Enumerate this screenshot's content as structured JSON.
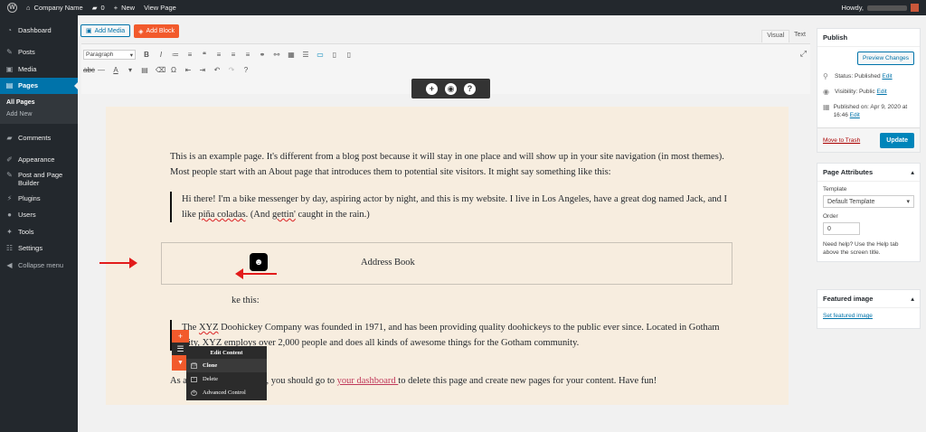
{
  "adminbar": {
    "site_name": "Company Name",
    "comments_count": "0",
    "new_label": "New",
    "view_label": "View Page",
    "howdy": "Howdy,"
  },
  "sidebar": {
    "items": [
      {
        "label": "Dashboard",
        "icon": "dashboard-icon"
      },
      {
        "label": "Posts",
        "icon": "pin-icon"
      },
      {
        "label": "Media",
        "icon": "media-icon"
      },
      {
        "label": "Pages",
        "icon": "pages-icon"
      },
      {
        "label": "Comments",
        "icon": "comment-icon"
      },
      {
        "label": "Appearance",
        "icon": "brush-icon"
      },
      {
        "label": "Post and Page Builder",
        "icon": "builder-icon"
      },
      {
        "label": "Plugins",
        "icon": "plug-icon"
      },
      {
        "label": "Users",
        "icon": "users-icon"
      },
      {
        "label": "Tools",
        "icon": "wrench-icon"
      },
      {
        "label": "Settings",
        "icon": "settings-icon"
      },
      {
        "label": "Collapse menu",
        "icon": "collapse-icon"
      }
    ],
    "submenu": [
      "All Pages",
      "Add New"
    ]
  },
  "editor": {
    "add_media": "Add Media",
    "add_block": "Add Block",
    "tab_visual": "Visual",
    "tab_text": "Text",
    "format": "Paragraph",
    "p1": "This is an example page. It's different from a blog post because it will stay in one place and will show up in your site navigation (in most themes). Most people start with an About page that introduces them to potential site visitors. It might say something like this:",
    "q1_a": "Hi there! I'm a bike messenger by day, aspiring actor by night, and this is my website. I live in Los Angeles, have a great dog named Jack, and I like ",
    "q1_b": "piña coladas",
    "q1_c": ". (And ",
    "q1_d": "gettin'",
    "q1_e": " caught in the rain.)",
    "address_title": "Address Book",
    "partial": "ke this:",
    "q2_a": "The ",
    "q2_b": "XYZ",
    "q2_c": " Doohickey Company was founded in 1971, and has been providing quality doohickeys to the public ever since. Located in Gotham City, ",
    "q2_d": "XYZ",
    "q2_e": " employs over 2,000 people and does all kinds of awesome things for the Gotham community.",
    "p_last_a": "As a new WordPress user, you should go to ",
    "p_last_link": " your dashboard ",
    "p_last_b": " to delete this page and create new pages for your content. Have fun!"
  },
  "context_menu": {
    "header": "Edit Content",
    "items": [
      "Clone",
      "Delete",
      "Advanced Control"
    ]
  },
  "publish": {
    "title": "Publish",
    "preview": "Preview Changes",
    "status_label": "Status: Published",
    "visibility_label": "Visibility: Public",
    "published_on": "Published on: Apr 9, 2020 at 16:46",
    "edit": "Edit",
    "trash": "Move to Trash",
    "update": "Update"
  },
  "attributes": {
    "title": "Page Attributes",
    "template_label": "Template",
    "template_value": "Default Template",
    "order_label": "Order",
    "order_value": "0",
    "help": "Need help? Use the Help tab above the screen title."
  },
  "featured": {
    "title": "Featured image",
    "link": "Set featured image"
  }
}
